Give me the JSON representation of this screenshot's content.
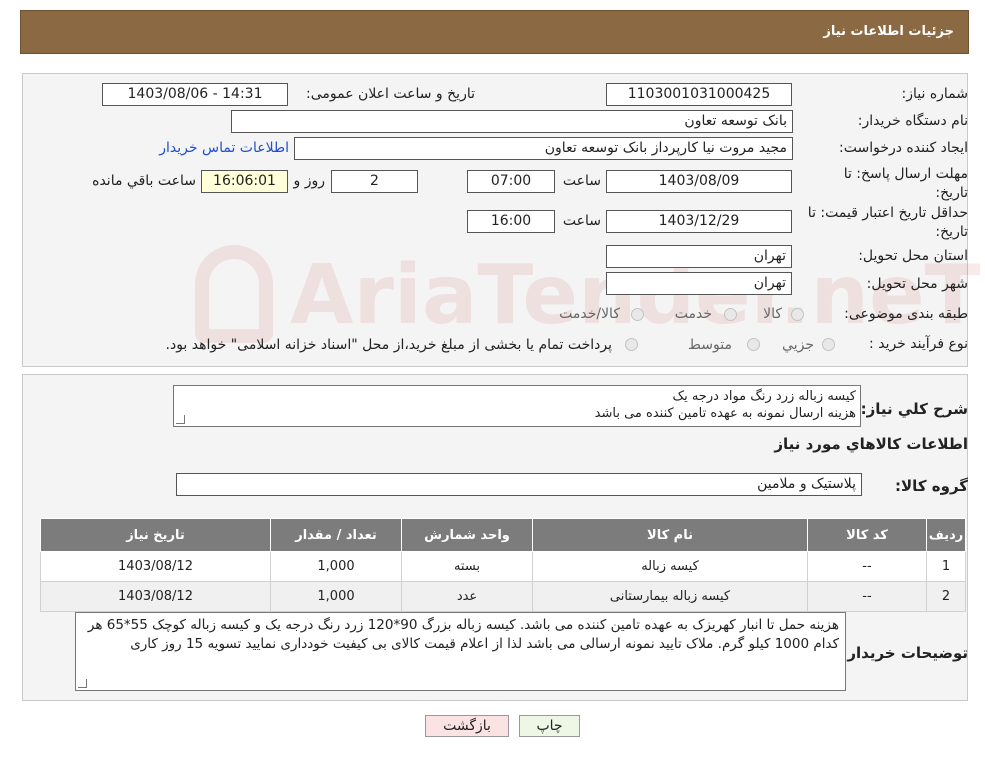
{
  "header": {
    "title": "جزئیات اطلاعات نیاز"
  },
  "watermark": "AriaTender.neT",
  "form": {
    "need_number_label": "شماره نیاز:",
    "need_number": "1103001031000425",
    "announce_label": "تاریخ و ساعت اعلان عمومی:",
    "announce_value": "1403/08/06 - 14:31",
    "buyer_label": "نام دستگاه خریدار:",
    "buyer_value": "بانک توسعه تعاون",
    "creator_label": "ایجاد کننده درخواست:",
    "creator_value": "مجید مروت نیا کارپرداز بانک توسعه تعاون",
    "contact_link": "اطلاعات تماس خریدار",
    "deadline_label": "مهلت ارسال پاسخ: تا تاریخ:",
    "deadline_date": "1403/08/09",
    "time_label": "ساعت",
    "deadline_time": "07:00",
    "days_value": "2",
    "days_label": "روز و",
    "remaining_time": "16:06:01",
    "remaining_label": "ساعت باقي مانده",
    "validity_label": "حداقل تاریخ اعتبار قیمت: تا تاریخ:",
    "validity_date": "1403/12/29",
    "validity_time": "16:00",
    "province_label": "استان محل تحویل:",
    "province_value": "تهران",
    "city_label": "شهر محل تحویل:",
    "city_value": "تهران",
    "category_label": "طبقه بندی موضوعی:",
    "category_options": [
      "کالا",
      "خدمت",
      "کالا/خدمت"
    ],
    "process_label": "نوع فرآیند خرید :",
    "process_options": [
      "جزيي",
      "متوسط"
    ],
    "process_note": "پرداخت تمام یا بخشی از مبلغ خرید،از محل \"اسناد خزانه اسلامی\" خواهد بود."
  },
  "details": {
    "summary_label": "شرح کلي نياز:",
    "summary_lines": [
      "کیسه زباله زرد رنگ مواد درجه یک",
      "هزینه ارسال نمونه به عهده تامین کننده می باشد"
    ],
    "goods_info_title": "اطلاعات کالاهاي مورد نياز",
    "group_label": "گروه کالا:",
    "group_value": "پلاستیک و ملامین"
  },
  "table": {
    "headers": [
      "رديف",
      "کد کالا",
      "نام کالا",
      "واحد شمارش",
      "تعداد / مقدار",
      "تاريخ نياز"
    ],
    "rows": [
      [
        "1",
        "--",
        "کیسه زباله",
        "بسته",
        "1,000",
        "1403/08/12"
      ],
      [
        "2",
        "--",
        "کیسه زباله بیمارستانی",
        "عدد",
        "1,000",
        "1403/08/12"
      ]
    ]
  },
  "buyer_notes": {
    "label": "توضیحات خریدار:",
    "text": "هزینه حمل تا انبار کهریزک به عهده تامین کننده می باشد. کیسه زباله بزرگ 90*120 زرد رنگ درجه یک و کیسه زباله کوچک 55*65 هر کدام 1000 کیلو گرم. ملاک تایید نمونه ارسالی می باشد لذا از اعلام قیمت کالای بی کیفیت خودداری نمایید تسویه 15 روز کاری"
  },
  "buttons": {
    "print": "چاپ",
    "back": "بازگشت"
  },
  "colors": {
    "header_bg": "#8b6a43",
    "panel_bg": "#f4f4f4",
    "table_header": "#7c7c7c",
    "link": "#1f4fd1",
    "back_bg": "#fbe3e3",
    "print_bg": "#eef7e6"
  }
}
